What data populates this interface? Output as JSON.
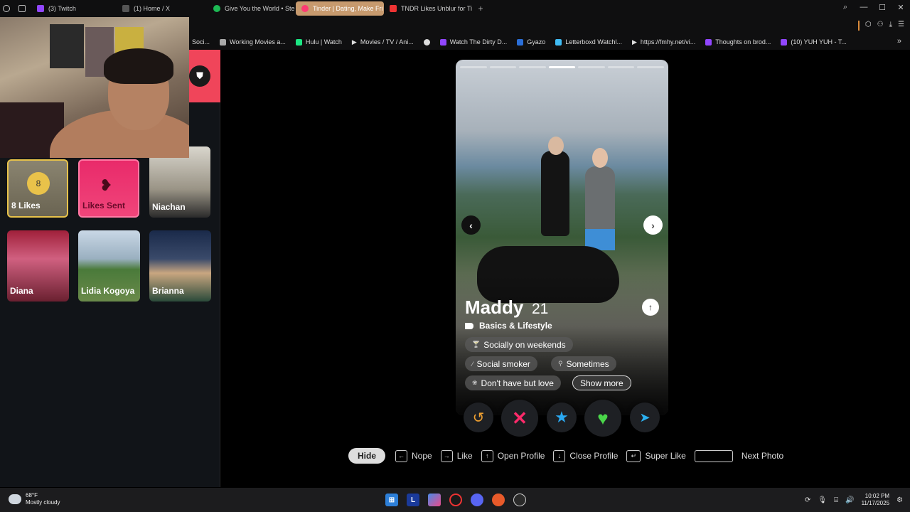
{
  "browser": {
    "tabs": [
      {
        "label": "(3) Twitch",
        "color": "#9146ff",
        "active": false
      },
      {
        "label": "(1) Home / X",
        "color": "#000000",
        "active": false
      },
      {
        "label": "Give You the World • Ste",
        "color": "#1db954",
        "active": false
      },
      {
        "label": "Tinder | Dating, Make Fri",
        "color": "#fd3a73",
        "active": true
      },
      {
        "label": "TNDR Likes Unblur for Tin",
        "color": "#e33",
        "active": false
      }
    ],
    "new_tab": "+",
    "bookmarks": [
      {
        "label": "Soci...",
        "color": "#888"
      },
      {
        "label": "Working Movies a...",
        "color": "#aaa"
      },
      {
        "label": "Hulu | Watch",
        "color": "#1ce783"
      },
      {
        "label": "Movies / TV / Ani...",
        "color": "#ddd"
      },
      {
        "label": "",
        "color": "#ddd"
      },
      {
        "label": "Watch The Dirty D...",
        "color": "#9146ff"
      },
      {
        "label": "Gyazo",
        "color": "#2b6fd8"
      },
      {
        "label": "Letterboxd Watchl...",
        "color": "#40bcf4"
      },
      {
        "label": "https://fmhy.net/vi...",
        "color": "#ddd"
      },
      {
        "label": "Thoughts on brod...",
        "color": "#9146ff"
      },
      {
        "label": "(10) YUH YUH - T...",
        "color": "#9146ff"
      }
    ]
  },
  "sidebar": {
    "likes_badge": "8",
    "likes_label": "8 Likes",
    "sent_label": "Likes Sent",
    "matches": [
      "Niachan",
      "Diana",
      "Lidia Kogoya",
      "Brianna"
    ]
  },
  "profile": {
    "name": "Maddy",
    "age": "21",
    "section_title": "Basics & Lifestyle",
    "chips": [
      "Socially on weekends",
      "Social smoker",
      "Sometimes",
      "Don't have but love"
    ],
    "show_more": "Show more",
    "photo_count": 7,
    "current_photo": 4
  },
  "shortcuts": {
    "hide": "Hide",
    "nope": "Nope",
    "like": "Like",
    "open_profile": "Open Profile",
    "close_profile": "Close Profile",
    "super_like": "Super Like",
    "next_photo": "Next Photo"
  },
  "taskbar": {
    "temp": "68°F",
    "condition": "Mostly cloudy",
    "time": "10:02 PM",
    "date": "11/17/2025",
    "apps": [
      "windows",
      "L",
      "copilot",
      "opera",
      "discord",
      "app6",
      "app7"
    ]
  }
}
